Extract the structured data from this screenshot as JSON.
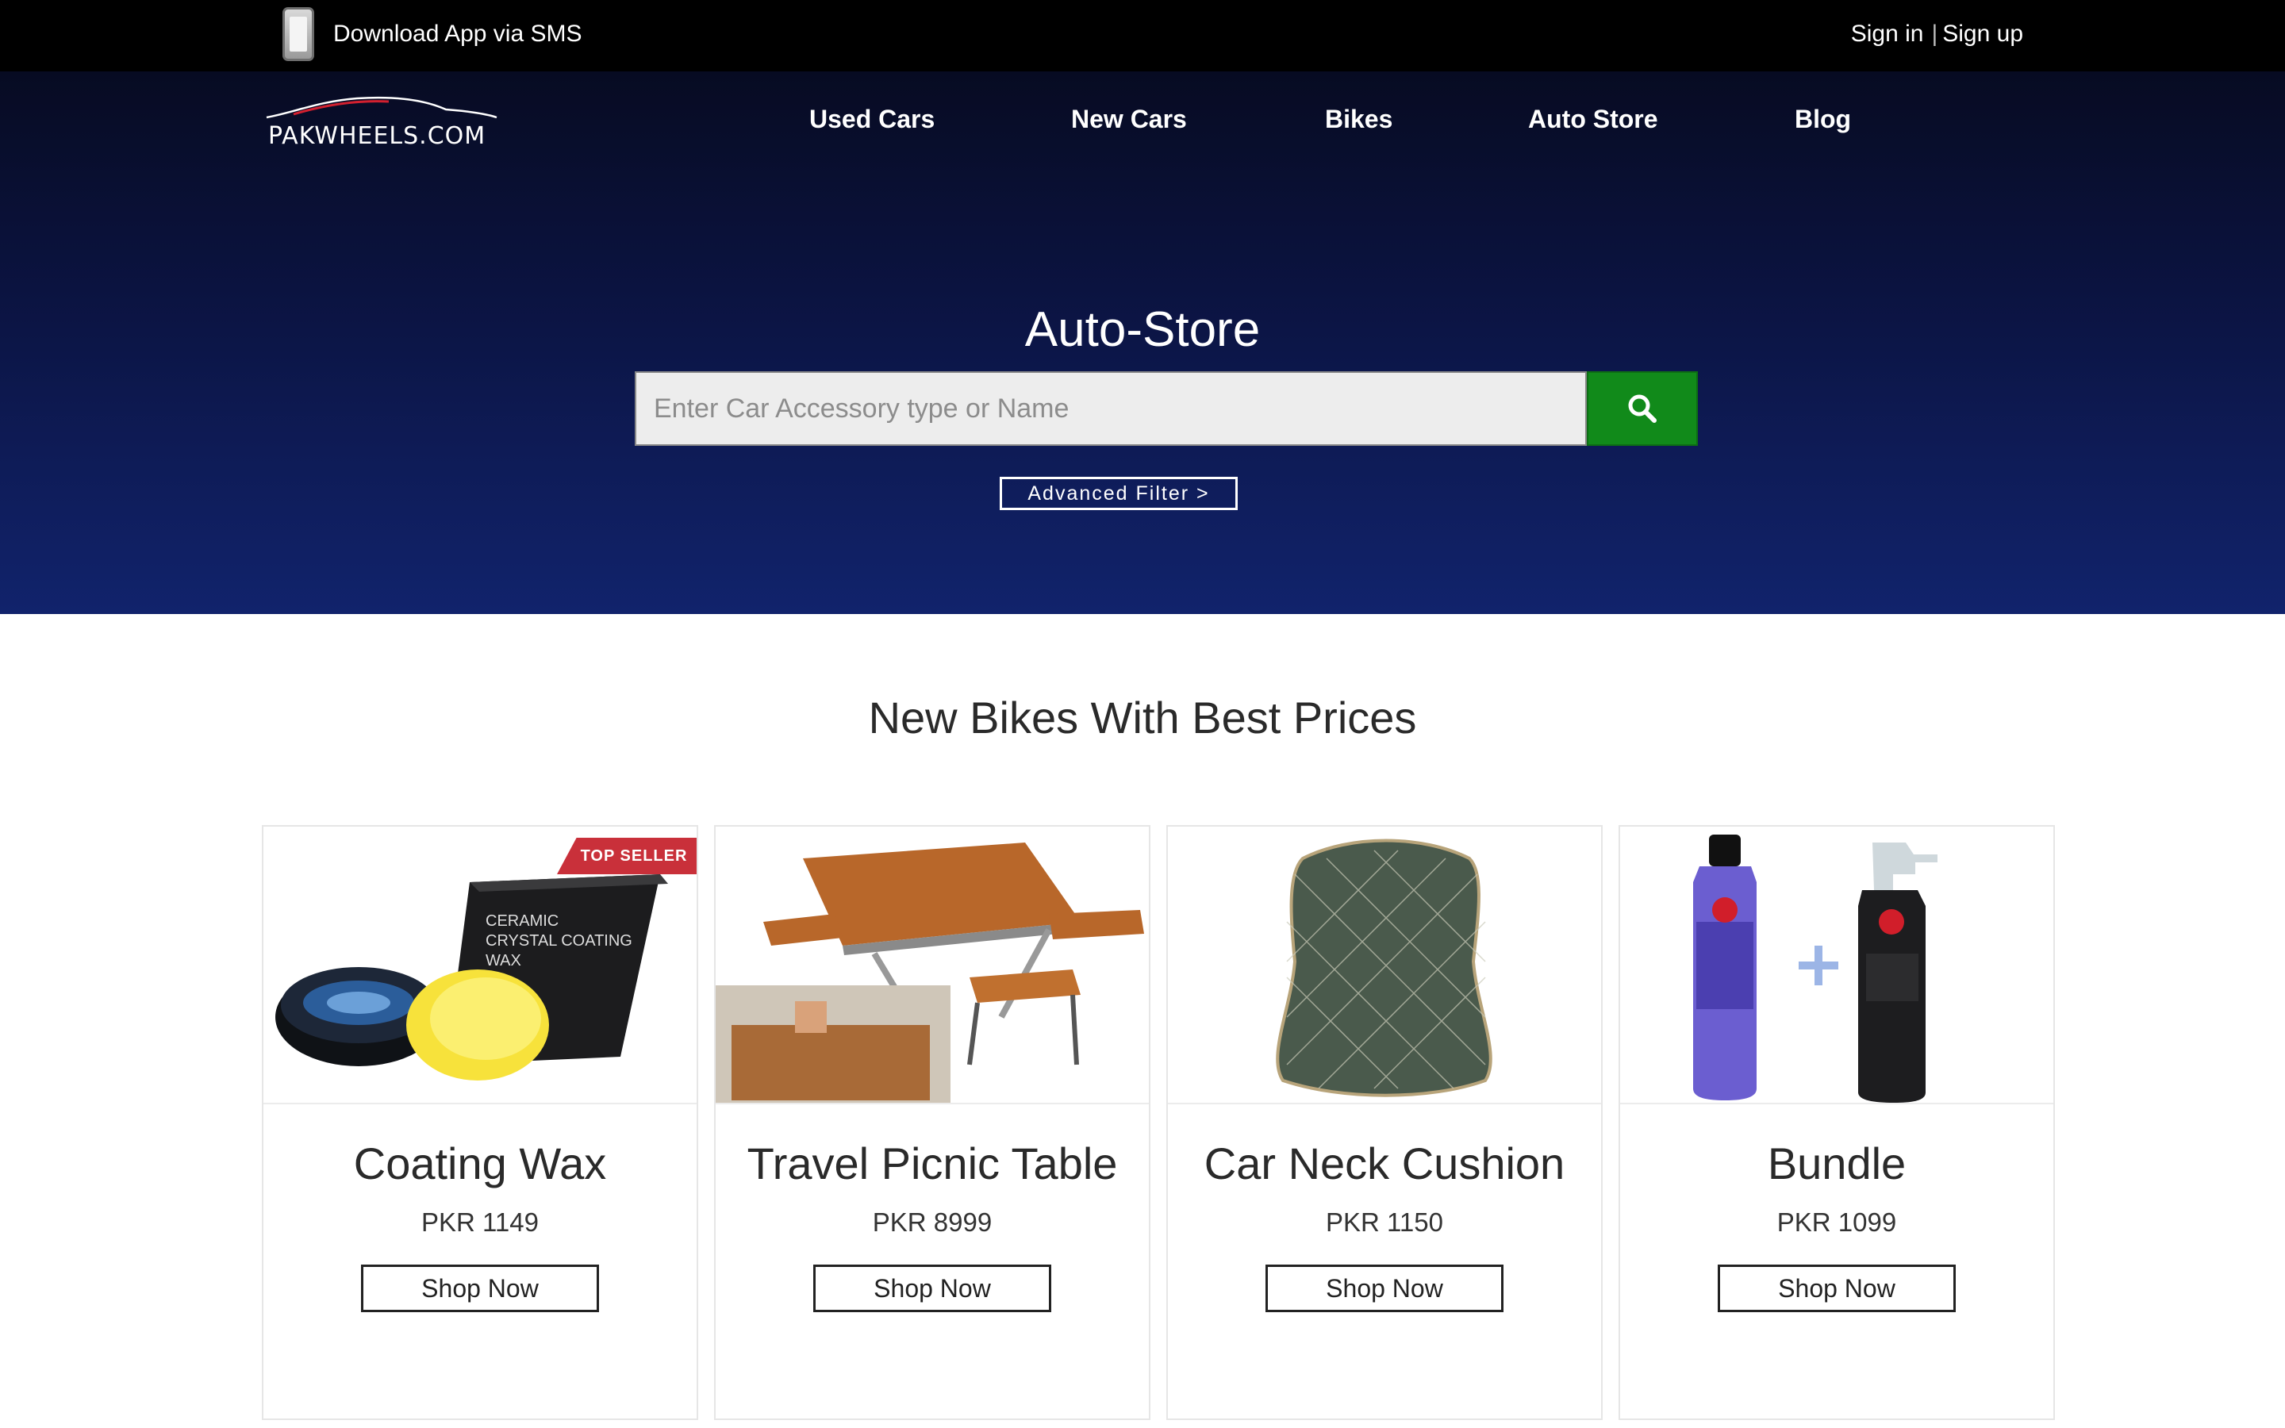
{
  "topbar": {
    "app_label": "Download App via SMS",
    "sign_in": "Sign in",
    "separator": "|",
    "sign_up": "Sign up"
  },
  "brand": {
    "logo_text": "PAKWHEELS.COM"
  },
  "nav": {
    "items": [
      {
        "label": "Used Cars"
      },
      {
        "label": "New Cars"
      },
      {
        "label": "Bikes"
      },
      {
        "label": "Auto Store"
      },
      {
        "label": "Blog"
      }
    ]
  },
  "hero": {
    "title": "Auto-Store",
    "search_placeholder": "Enter Car Accessory type or Name",
    "advanced_filter": "Advanced Filter >"
  },
  "section": {
    "title": "New Bikes With Best Prices",
    "products": [
      {
        "name": "Coating Wax",
        "price": "PKR 1149",
        "button": "Shop Now",
        "badge": "TOP SELLER"
      },
      {
        "name": "Travel Picnic Table",
        "price": "PKR 8999",
        "button": "Shop Now"
      },
      {
        "name": "Car Neck Cushion",
        "price": "PKR 1150",
        "button": "Shop Now"
      },
      {
        "name": "Bundle",
        "price": "PKR 1099",
        "button": "Shop Now"
      }
    ]
  },
  "colors": {
    "topbar": "#000000",
    "hero_dark": "#070b22",
    "hero_light": "#11236c",
    "search_button": "#118a1a",
    "badge": "#c9303a"
  },
  "icons": {
    "phone": "phone-icon",
    "search": "search-icon"
  }
}
